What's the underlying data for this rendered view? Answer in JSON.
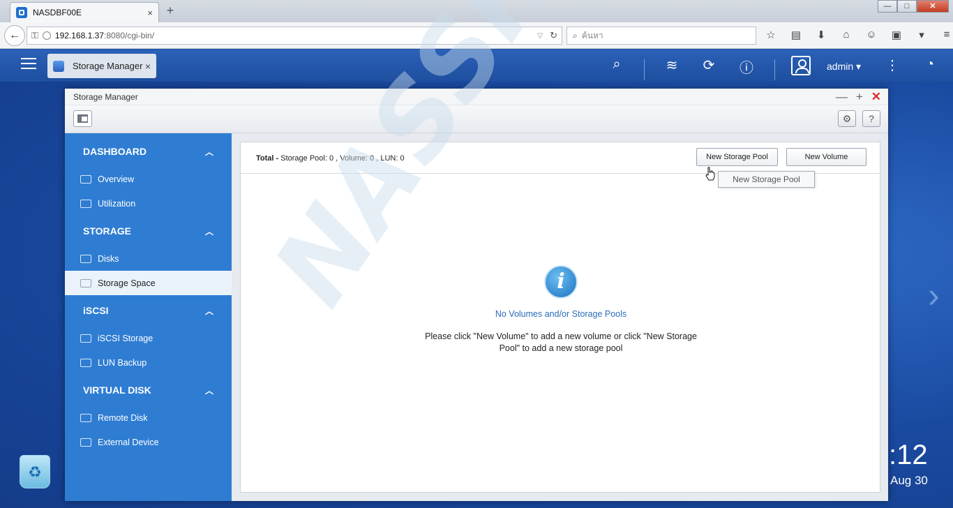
{
  "browser": {
    "tab_title": "NASDBF00E",
    "tab_close": "×",
    "new_tab": "+",
    "url_host": "192.168.1.37",
    "url_rest": ":8080/cgi-bin/",
    "search_placeholder": "ค้นหา",
    "window_controls": [
      "—",
      "□",
      "✕"
    ]
  },
  "qts": {
    "app_tab_label": "Storage Manager",
    "app_tab_close": "×",
    "user": "admin ▾"
  },
  "window": {
    "title": "Storage Manager",
    "controls": [
      "—",
      "+",
      "✕"
    ],
    "help": "?"
  },
  "sidebar": {
    "sections": [
      {
        "label": "DASHBOARD",
        "items": [
          "Overview",
          "Utilization"
        ]
      },
      {
        "label": "STORAGE",
        "items": [
          "Disks",
          "Storage Space"
        ]
      },
      {
        "label": "iSCSI",
        "items": [
          "iSCSI Storage",
          "LUN Backup"
        ]
      },
      {
        "label": "VIRTUAL DISK",
        "items": [
          "Remote Disk",
          "External Device"
        ]
      }
    ],
    "active_item": "Storage Space"
  },
  "panel": {
    "total_label": "Total -",
    "total_text": "Storage Pool: 0 , Volume: 0 , LUN: 0",
    "new_pool_button": "New Storage Pool",
    "new_volume_button": "New Volume",
    "tooltip": "New Storage Pool",
    "empty_title": "No Volumes and/or Storage Pools",
    "empty_message": "Please click \"New Volume\" to add a new volume or click \"New Storage Pool\" to add a new storage pool",
    "info_glyph": "i"
  },
  "desktop": {
    "clock": ":12",
    "date": "Aug 30",
    "watermark": "NASSHOPS.net"
  }
}
